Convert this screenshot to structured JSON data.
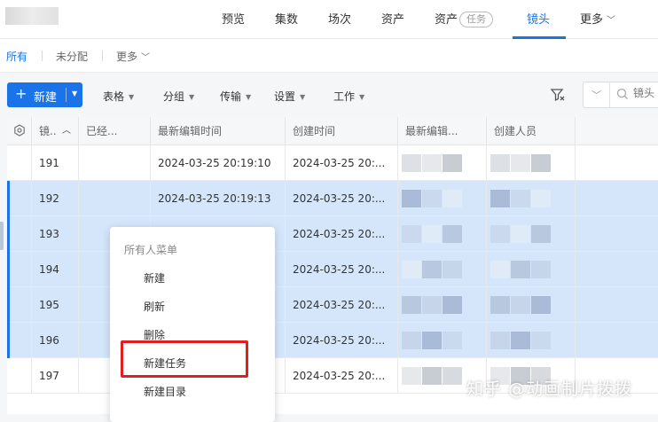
{
  "topnav": {
    "items": [
      {
        "label": "预览"
      },
      {
        "label": "集数"
      },
      {
        "label": "场次"
      },
      {
        "label": "资产"
      },
      {
        "label": "资产",
        "chip": "任务"
      },
      {
        "label": "镜头",
        "active": true
      },
      {
        "label": "更多"
      }
    ]
  },
  "subtabs": {
    "all": "所有",
    "unassigned": "未分配",
    "more": "更多"
  },
  "toolbar": {
    "new_label": "新建",
    "menus": [
      "表格",
      "分组",
      "传输",
      "设置",
      "工作"
    ],
    "search_placeholder": "镜头"
  },
  "table": {
    "headers": [
      "镜..",
      "已经...",
      "最新编辑时间",
      "创建时间",
      "最新编辑...",
      "创建人员"
    ],
    "rows": [
      {
        "id": "191",
        "edit": "2024-03-25 20:19:10",
        "created": "2024-03-25 20:...",
        "selected": false
      },
      {
        "id": "192",
        "edit": "2024-03-25 20:19:13",
        "created": "2024-03-25 20:...",
        "selected": true
      },
      {
        "id": "193",
        "edit": "",
        "created": "2024-03-25 20:...",
        "selected": true
      },
      {
        "id": "194",
        "edit": "",
        "created": "2024-03-25 20:...",
        "selected": true
      },
      {
        "id": "195",
        "edit": "",
        "created": "2024-03-25 20:...",
        "selected": true
      },
      {
        "id": "196",
        "edit": "",
        "created": "2024-03-25 20:...",
        "selected": true
      },
      {
        "id": "197",
        "edit": "",
        "created": "2024-03-25 20:...",
        "selected": false
      }
    ]
  },
  "context_menu": {
    "title": "所有人菜单",
    "items": [
      "新建",
      "刷新",
      "删除",
      "新建任务",
      "新建目录"
    ]
  },
  "watermark": "知乎 @动画制片拨拨",
  "colors": {
    "accent": "#1a73e8",
    "selected_row": "#d5e6fb",
    "highlight_box": "#e0201f"
  }
}
